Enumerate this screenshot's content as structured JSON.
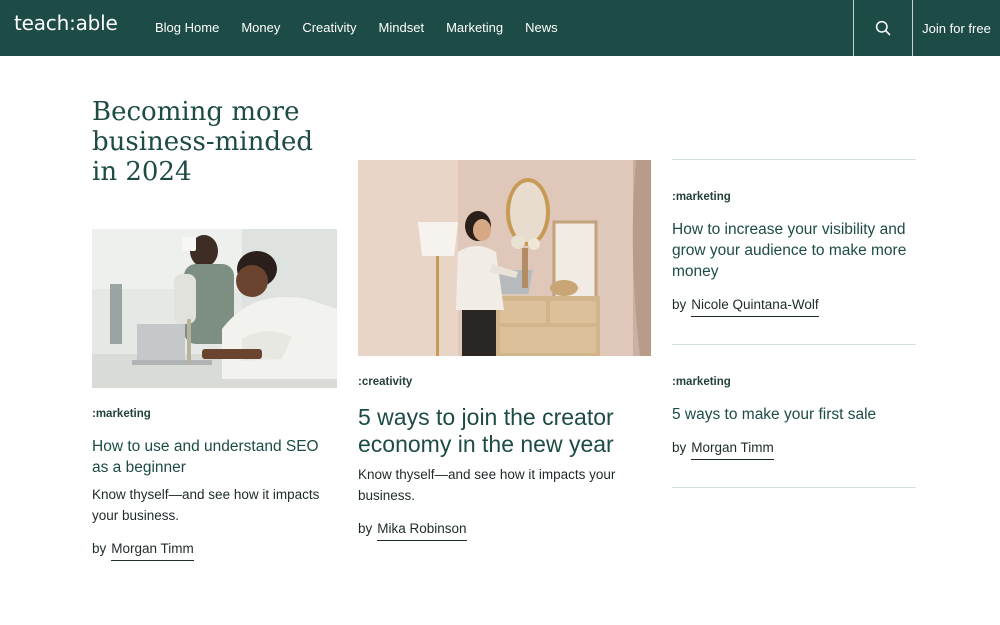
{
  "header": {
    "logo": "teach:able",
    "nav": [
      "Blog Home",
      "Money",
      "Creativity",
      "Mindset",
      "Marketing",
      "News"
    ],
    "join_label": "Join for free"
  },
  "section": {
    "title": "Becoming more business-minded in 2024"
  },
  "articles": [
    {
      "tag": ":marketing",
      "title": "How to use and understand SEO as a beginner",
      "description": "Know thyself—and see how it impacts your business.",
      "by": "by",
      "author": "Morgan Timm"
    },
    {
      "tag": ":creativity",
      "title": "5 ways to join the creator economy in the new year",
      "description": "Know thyself—and see how it impacts your business.",
      "by": "by",
      "author": "Mika Robinson"
    },
    {
      "tag": ":marketing",
      "title": "How to increase your visibility and grow your audience to make more money",
      "by": "by",
      "author": "Nicole Quintana-Wolf"
    },
    {
      "tag": ":marketing",
      "title": "5 ways to make your first sale",
      "by": "by",
      "author": "Morgan Timm"
    }
  ],
  "colors": {
    "brand_green": "#1d4b45",
    "divider": "#cfe3e0"
  }
}
